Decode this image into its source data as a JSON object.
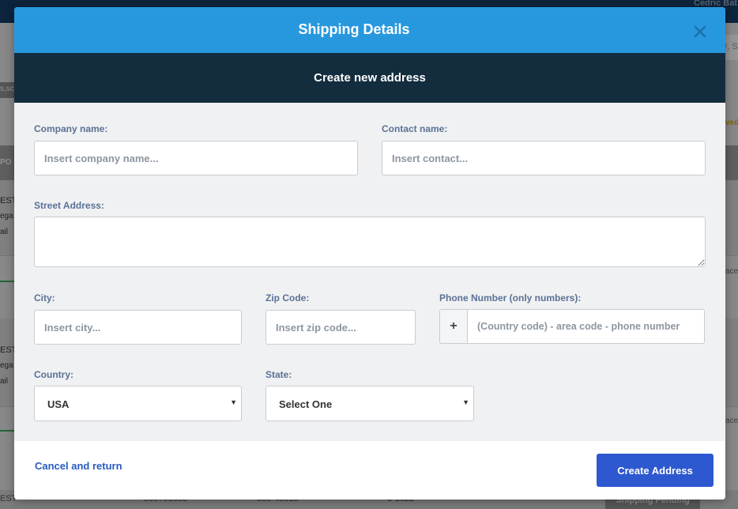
{
  "background": {
    "user_name": "Cedric Bat",
    "search_hint": "#, S",
    "tag_text": "s,sc",
    "status_fragment": "ved",
    "table_header_fragment": "PO",
    "rows": [
      {
        "line1": "EST",
        "line2": "ega",
        "line3": "ail",
        "right": "ace"
      },
      {
        "line1": "EST",
        "line2": "ega",
        "line3": "ail",
        "right": "ace"
      }
    ],
    "bottom_row": {
      "col1": "EST",
      "col2": "500703083",
      "col3": "895-48613",
      "col4": "3-1622",
      "status": "Shipping Pending"
    }
  },
  "modal": {
    "title": "Shipping Details",
    "close_icon": "close-icon",
    "subtitle": "Create new address",
    "fields": {
      "company_name": {
        "label": "Company name:",
        "placeholder": "Insert company name...",
        "value": ""
      },
      "contact_name": {
        "label": "Contact name:",
        "placeholder": "Insert contact...",
        "value": ""
      },
      "street_address": {
        "label": "Street Address:",
        "placeholder": "",
        "value": ""
      },
      "city": {
        "label": "City:",
        "placeholder": "Insert city...",
        "value": ""
      },
      "zip_code": {
        "label": "Zip Code:",
        "placeholder": "Insert zip code...",
        "value": ""
      },
      "phone": {
        "label": "Phone Number (only numbers):",
        "prefix": "+",
        "placeholder": "(Country code) - area code - phone number",
        "value": ""
      },
      "country": {
        "label": "Country:",
        "value": "USA"
      },
      "state": {
        "label": "State:",
        "value": "Select One"
      }
    },
    "footer": {
      "cancel_label": "Cancel and return",
      "create_label": "Create Address"
    }
  },
  "colors": {
    "header_bg": "#2898de",
    "subheader_bg": "#132d3e",
    "primary_button": "#2e58cf",
    "label_text": "#5b7194",
    "link_text": "#2a5bbf"
  }
}
